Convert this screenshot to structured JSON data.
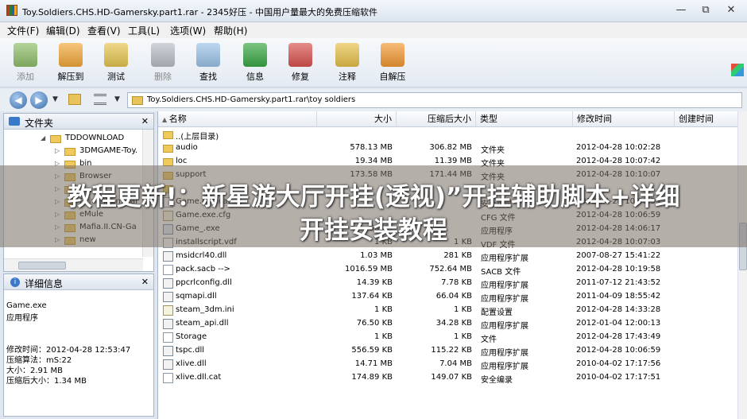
{
  "window": {
    "title": "Toy.Soldiers.CHS.HD-Gamersky.part1.rar - 2345好压 - 中国用户量最大的免费压缩软件",
    "controls": [
      "—",
      "⧉",
      "✕"
    ]
  },
  "menu": [
    "文件(F)",
    "编辑(D)",
    "查看(V)",
    "工具(L)",
    "选项(W)",
    "帮助(H)"
  ],
  "toolbar": [
    {
      "label": "添加",
      "icon": "add-icon",
      "color": "#8fbf6a",
      "disabled": true
    },
    {
      "label": "解压到",
      "icon": "extract-icon",
      "color": "#f2a93b",
      "disabled": false
    },
    {
      "label": "测试",
      "icon": "test-icon",
      "color": "#e6c550",
      "disabled": false
    },
    {
      "label": "删除",
      "icon": "delete-icon",
      "color": "#b9bfc7",
      "disabled": true
    },
    {
      "label": "查找",
      "icon": "find-icon",
      "color": "#9cc3e8",
      "disabled": false
    },
    {
      "label": "信息",
      "icon": "info-icon",
      "color": "#3aa845",
      "disabled": false
    },
    {
      "label": "修复",
      "icon": "repair-icon",
      "color": "#d9534f",
      "disabled": false
    },
    {
      "label": "注释",
      "icon": "comment-icon",
      "color": "#e7c14a",
      "disabled": false
    },
    {
      "label": "自解压",
      "icon": "sfx-icon",
      "color": "#f29a33",
      "disabled": false
    }
  ],
  "address": {
    "path": "Toy.Soldiers.CHS.HD-Gamersky.part1.rar\\toy soldiers"
  },
  "folder_panel": {
    "title": "文件夹",
    "items": [
      {
        "label": "TDDOWNLOAD",
        "level": 0,
        "expanded": true
      },
      {
        "label": "3DMGAME-Toy.",
        "level": 1,
        "expanded": false
      },
      {
        "label": "bin",
        "level": 1,
        "expanded": false
      },
      {
        "label": "Browser",
        "level": 1,
        "expanded": false
      },
      {
        "label": "",
        "level": 1,
        "expanded": false
      },
      {
        "label": "Driver.San.Frar",
        "level": 1,
        "expanded": false
      },
      {
        "label": "eMule",
        "level": 1,
        "expanded": false
      },
      {
        "label": "Mafia.II.CN-Ga",
        "level": 1,
        "expanded": false
      },
      {
        "label": "new",
        "level": 1,
        "expanded": false
      }
    ]
  },
  "info_panel": {
    "title": "详细信息",
    "name": "Game.exe",
    "type": "应用程序",
    "modified": "修改时间：2012-04-28 12:53:47",
    "method": "压缩算法：mS:22",
    "size": "大小：2.91 MB",
    "packed": "压缩后大小：1.34 MB"
  },
  "columns": {
    "name": "名称",
    "size": "大小",
    "packed": "压缩后大小",
    "type": "类型",
    "modified": "修改时间",
    "created": "创建时间"
  },
  "files": [
    {
      "name": "..(上层目录)",
      "size": "",
      "packed": "",
      "type": "",
      "modified": "",
      "kind": "folder"
    },
    {
      "name": "audio",
      "size": "578.13 MB",
      "packed": "306.82 MB",
      "type": "文件夹",
      "modified": "2012-04-28 10:02:28",
      "kind": "folder"
    },
    {
      "name": "loc",
      "size": "19.34 MB",
      "packed": "11.39 MB",
      "type": "文件夹",
      "modified": "2012-04-28 10:07:42",
      "kind": "folder"
    },
    {
      "name": "support",
      "size": "173.58 MB",
      "packed": "171.44 MB",
      "type": "文件夹",
      "modified": "2012-04-28 10:10:07",
      "kind": "folder"
    },
    {
      "name": "",
      "size": "",
      "packed": "",
      "type": "",
      "modified": "",
      "kind": "folder"
    },
    {
      "name": "Game.exe.cat",
      "size": "",
      "packed": "",
      "type": "安全编录",
      "modified": "2012-04-28 10:06:59",
      "kind": "file"
    },
    {
      "name": "Game.exe.cfg",
      "size": "",
      "packed": "",
      "type": "CFG 文件",
      "modified": "2012-04-28 10:06:59",
      "kind": "cfg"
    },
    {
      "name": "Game_.exe",
      "size": "58 KB",
      "packed": "",
      "type": "应用程序",
      "modified": "2012-04-28 14:06:17",
      "kind": "exe"
    },
    {
      "name": "installscript.vdf",
      "size": "1 KB",
      "packed": "1 KB",
      "type": "VDF 文件",
      "modified": "2012-04-28 10:07:03",
      "kind": "file"
    },
    {
      "name": "msidcrl40.dll",
      "size": "1.03 MB",
      "packed": "281 KB",
      "type": "应用程序扩展",
      "modified": "2007-08-27 15:41:22",
      "kind": "dll"
    },
    {
      "name": "pack.sacb -->",
      "size": "1016.59 MB",
      "packed": "752.64 MB",
      "type": "SACB 文件",
      "modified": "2012-04-28 10:19:58",
      "kind": "file"
    },
    {
      "name": "ppcrlconfig.dll",
      "size": "14.39 KB",
      "packed": "7.78 KB",
      "type": "应用程序扩展",
      "modified": "2011-07-12 21:43:52",
      "kind": "dll"
    },
    {
      "name": "sqmapi.dll",
      "size": "137.64 KB",
      "packed": "66.04 KB",
      "type": "应用程序扩展",
      "modified": "2011-04-09 18:55:42",
      "kind": "dll"
    },
    {
      "name": "steam_3dm.ini",
      "size": "1 KB",
      "packed": "1 KB",
      "type": "配置设置",
      "modified": "2012-04-28 14:33:28",
      "kind": "cfg"
    },
    {
      "name": "steam_api.dll",
      "size": "76.50 KB",
      "packed": "34.28 KB",
      "type": "应用程序扩展",
      "modified": "2012-01-04 12:00:13",
      "kind": "dll"
    },
    {
      "name": "Storage",
      "size": "1 KB",
      "packed": "1 KB",
      "type": "文件",
      "modified": "2012-04-28 17:43:49",
      "kind": "file"
    },
    {
      "name": "tspc.dll",
      "size": "556.59 KB",
      "packed": "115.22 KB",
      "type": "应用程序扩展",
      "modified": "2012-04-28 10:06:59",
      "kind": "dll"
    },
    {
      "name": "xlive.dll",
      "size": "14.71 MB",
      "packed": "7.04 MB",
      "type": "应用程序扩展",
      "modified": "2010-04-02 17:17:56",
      "kind": "dll"
    },
    {
      "name": "xlive.dll.cat",
      "size": "174.89 KB",
      "packed": "149.07 KB",
      "type": "安全编录",
      "modified": "2010-04-02 17:17:51",
      "kind": "file"
    }
  ],
  "overlay": {
    "line1": "教程更新!：新星游大厅开挂(透视)”开挂辅助脚本+详细",
    "line2": "开挂安装教程"
  }
}
